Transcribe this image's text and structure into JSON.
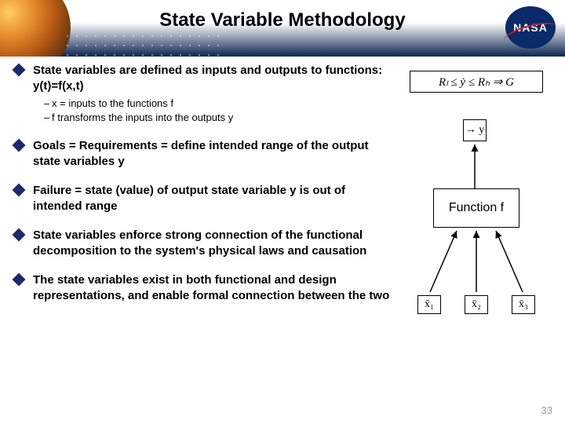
{
  "header": {
    "title": "State Variable Methodology",
    "logo_text": "NASA"
  },
  "bullets": [
    {
      "text": "State variables are defined as inputs and outputs to functions:  y(t)=f(x,t)",
      "subs": [
        "x = inputs to the functions f",
        "f transforms the inputs into the outputs y"
      ]
    },
    {
      "text": "Goals = Requirements = define intended range of the output state variables y",
      "subs": []
    },
    {
      "text": "Failure = state (value) of output state variable y is out of intended range",
      "subs": []
    },
    {
      "text": "State variables enforce strong connection of the functional decomposition to the system's physical laws and causation",
      "subs": []
    },
    {
      "text": "The state variables exist in both functional and design representations, and enable formal connection between the two",
      "subs": []
    }
  ],
  "diagram": {
    "constraint": "Rₗ ≤ ẏ ≤ Rₕ ⇒ G",
    "y_label": "→ y",
    "function_label": "Function f",
    "x_labels": [
      "x̄₁",
      "x̄₂",
      "x̄₃"
    ]
  },
  "page_number": "33"
}
